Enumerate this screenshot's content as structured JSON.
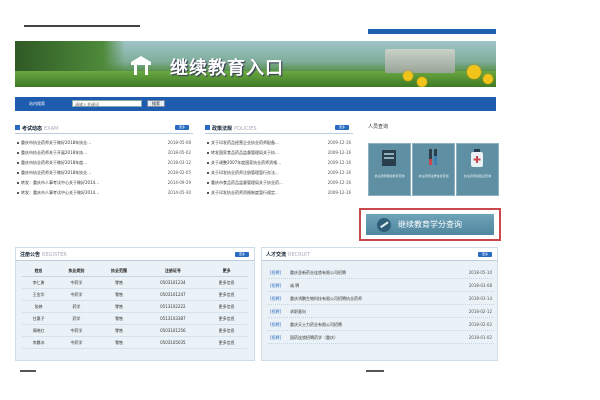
{
  "banner": {
    "title": "继续教育入口"
  },
  "search": {
    "label": "站内搜索",
    "placeholder": "请输入关键词",
    "button": "搜索"
  },
  "exam_news": {
    "title": "考试动态",
    "en": "EXAM",
    "more": "更多",
    "items": [
      {
        "text": "重庆市执业药师关于做好2018年执业...",
        "date": "2018-05-08"
      },
      {
        "text": "重庆市执业药师关于开展2018年执...",
        "date": "2018-05-02"
      },
      {
        "text": "重庆市执业药师关于做好2018年度...",
        "date": "2018-03-12"
      },
      {
        "text": "重庆市执业药师关于做好2018年执业...",
        "date": "2018-02-05"
      },
      {
        "text": "转发：重庆市人事考试中心关于做好2014...",
        "date": "2014-09-29"
      },
      {
        "text": "转发：重庆市人事考试中心关于做好2014...",
        "date": "2014-05-30"
      }
    ]
  },
  "policy": {
    "title": "政策法规",
    "en": "POLICIES",
    "more": "更多",
    "items": [
      {
        "text": "关于印发药品经营企业执业药师配备...",
        "date": "2009-12-16"
      },
      {
        "text": "转发国家食品药品监督管理局关于执...",
        "date": "2009-12-16"
      },
      {
        "text": "关于调整2007年度国家执业药师资格...",
        "date": "2009-12-16"
      },
      {
        "text": "关于印发执业药师注册管理暂行办法...",
        "date": "2009-12-16"
      },
      {
        "text": "重庆市食品药品监督管理局关于执业药...",
        "date": "2009-12-16"
      },
      {
        "text": "关于印发执业药师资格制度暂行规定...",
        "date": "2009-12-16"
      }
    ]
  },
  "people": {
    "title": "人员查询",
    "tiles": [
      {
        "caption": "执业药师继续教育查询",
        "icon": "book-icon"
      },
      {
        "caption": "执业药师注册信息查询",
        "icon": "test-tube-icon"
      },
      {
        "caption": "执业药师资格证查询",
        "icon": "medicine-bottle-icon"
      }
    ],
    "wide": {
      "label": "继续教育学分查询",
      "icon": "pen-icon"
    }
  },
  "register": {
    "title": "注册公告",
    "en": "REGISTER",
    "more": "更多",
    "columns": [
      "姓名",
      "执业类别",
      "执业范围",
      "注册证号",
      "更多"
    ],
    "rows": [
      [
        "李仁勇",
        "中药学",
        "零售",
        "0503101234",
        "更多信息"
      ],
      [
        "王金华",
        "中药学",
        "零售",
        "0503101247",
        "更多信息"
      ],
      [
        "张婷",
        "药学",
        "零售",
        "0513102222",
        "更多信息"
      ],
      [
        "甘惠子",
        "药学",
        "零售",
        "0513103387",
        "更多信息"
      ],
      [
        "周晓红",
        "中药学",
        "零售",
        "0503101256",
        "更多信息"
      ],
      [
        "李晨冰",
        "中药学",
        "零售",
        "0503105035",
        "更多信息"
      ]
    ]
  },
  "jobs": {
    "title": "人才交流",
    "en": "RECRUIT",
    "more": "更多",
    "items": [
      {
        "tag": "[招聘]",
        "text": "重庆圣新药业连锁有限公司招聘",
        "date": "2018-05-10"
      },
      {
        "tag": "[招聘]",
        "text": "诚 聘",
        "date": "2018-03-08"
      },
      {
        "tag": "[招聘]",
        "text": "重庆鸿鹏生物科技有限公司招聘执业药师",
        "date": "2018-03-14"
      },
      {
        "tag": "[招聘]",
        "text": "求职意向",
        "date": "2018-02-12"
      },
      {
        "tag": "[招聘]",
        "text": "重庆天士力药业有限公司招聘",
        "date": "2018-02-02"
      },
      {
        "tag": "[招聘]",
        "text": "国药连锁招聘药学（重庆）",
        "date": "2018-01-02"
      }
    ]
  }
}
